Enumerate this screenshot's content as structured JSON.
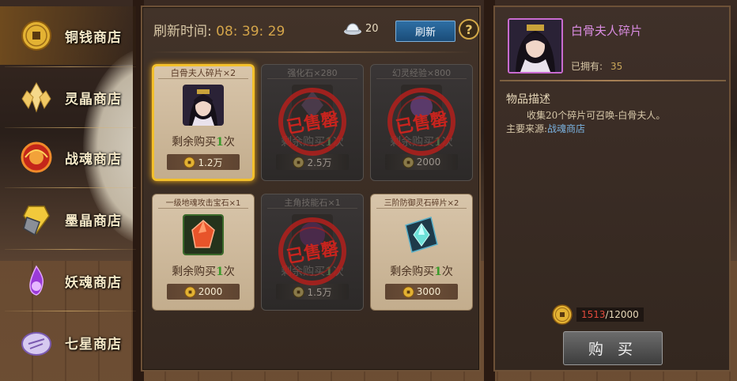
{
  "sidebar": {
    "items": [
      {
        "label": "铜钱商店",
        "icon": "copper-coin-icon",
        "active": true
      },
      {
        "label": "灵晶商店",
        "icon": "spirit-crystal-icon"
      },
      {
        "label": "战魂商店",
        "icon": "war-soul-icon"
      },
      {
        "label": "墨晶商店",
        "icon": "ink-crystal-icon"
      },
      {
        "label": "妖魂商店",
        "icon": "demon-soul-icon"
      },
      {
        "label": "七星商店",
        "icon": "seven-star-icon"
      }
    ]
  },
  "shop": {
    "refresh_time_label": "刷新时间:",
    "refresh_time_value": "08: 39: 29",
    "silver_count": "20",
    "refresh_button": "刷新",
    "help_button": "?",
    "items": [
      {
        "title": "白骨夫人碎片×2",
        "remaining_label": "剩余购买",
        "remaining_count": "1",
        "remaining_unit": "次",
        "price": "1.2万",
        "sold_out": false,
        "selected": true,
        "icon": "lady-portrait-icon"
      },
      {
        "title": "强化石×280",
        "remaining_label": "剩余购买",
        "remaining_count": "1",
        "remaining_unit": "次",
        "price": "2.5万",
        "sold_out": true,
        "stamp": "已售罄",
        "icon": "strengthen-stone-icon"
      },
      {
        "title": "幻灵经验×800",
        "remaining_label": "剩余购买",
        "remaining_count": "1",
        "remaining_unit": "次",
        "price": "2000",
        "sold_out": true,
        "stamp": "已售罄",
        "icon": "spirit-exp-icon"
      },
      {
        "title": "一级地魂攻击宝石×1",
        "remaining_label": "剩余购买",
        "remaining_count": "1",
        "remaining_unit": "次",
        "price": "2000",
        "sold_out": false,
        "icon": "red-gem-icon"
      },
      {
        "title": "主角技能石×1",
        "remaining_label": "剩余购买",
        "remaining_count": "1",
        "remaining_unit": "次",
        "price": "1.5万",
        "sold_out": true,
        "stamp": "已售罄",
        "icon": "skill-stone-icon"
      },
      {
        "title": "三阶防御灵石碎片×2",
        "remaining_label": "剩余购买",
        "remaining_count": "1",
        "remaining_unit": "次",
        "price": "3000",
        "sold_out": false,
        "icon": "cyan-crystal-icon"
      }
    ]
  },
  "detail": {
    "item_name": "白骨夫人碎片",
    "owned_label": "已拥有:",
    "owned_value": "35",
    "desc_title": "物品描述",
    "desc_text": "收集20个碎片可召唤-白骨夫人。",
    "source_label": "主要来源:",
    "source_value": "战魂商店",
    "currency_have": "1513",
    "currency_sep": "/",
    "currency_need": "12000",
    "buy_button": "购 买"
  },
  "colors": {
    "selected_border": "#f3c02b",
    "refresh_button": "#2e6fa5",
    "item_name": "#d98ce0",
    "insufficient": "#e24a3c",
    "remaining_count": "#3a9a2a"
  }
}
